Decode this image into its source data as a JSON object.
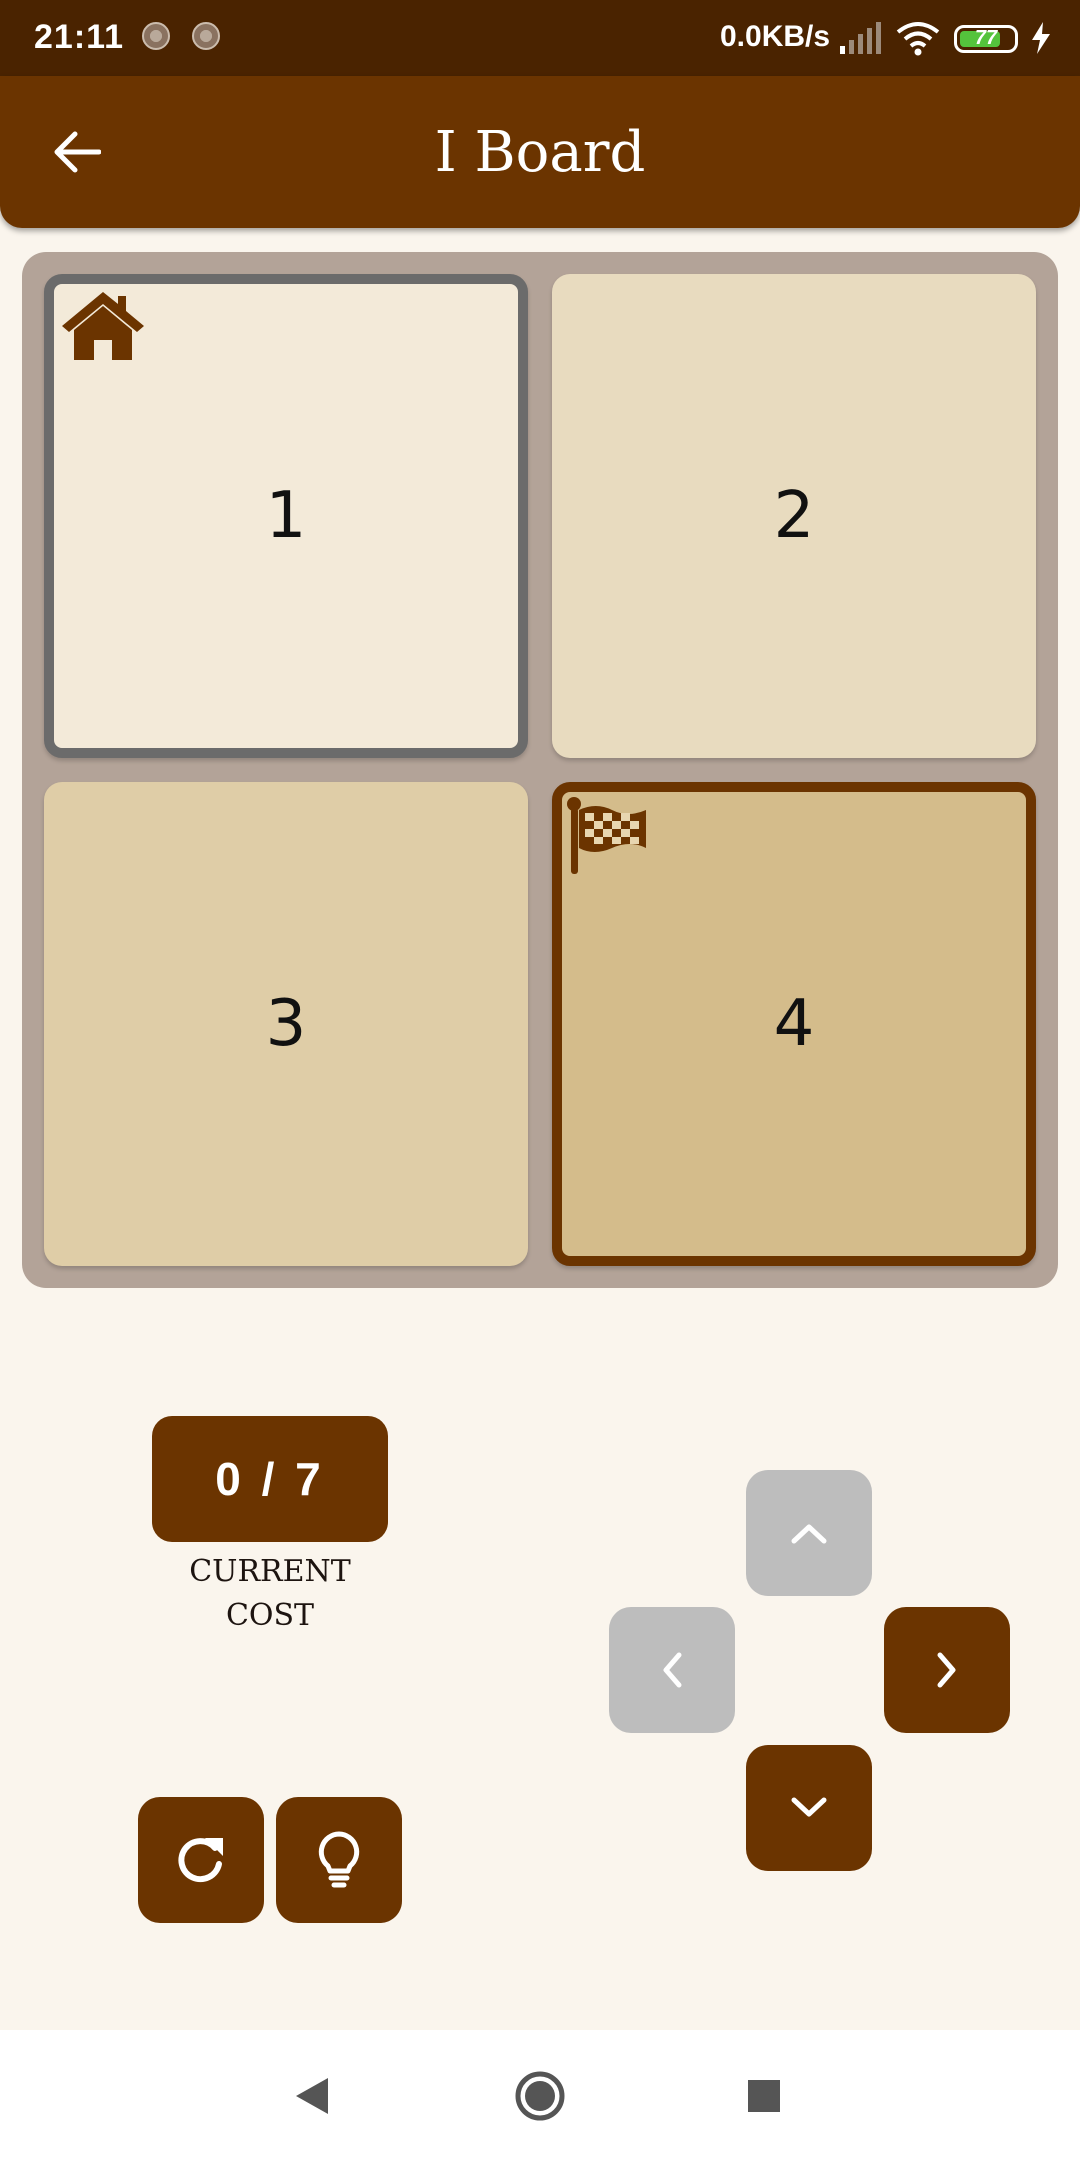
{
  "status_bar": {
    "time": "21:11",
    "network_speed": "0.0KB/s",
    "battery_level": "77",
    "icons": [
      "notification-dot-icon",
      "notification-dot-icon",
      "signal-icon",
      "wifi-icon",
      "battery-icon",
      "charging-bolt-icon"
    ]
  },
  "app_bar": {
    "title": "I Board",
    "back_icon": "arrow-left-icon"
  },
  "board": {
    "cells": [
      {
        "label": "1",
        "state": "start",
        "icon": "home-icon",
        "background": "#f3ead9",
        "border": "#6b6b6b"
      },
      {
        "label": "2",
        "state": "normal",
        "icon": "",
        "background": "#e8dbbf",
        "border": ""
      },
      {
        "label": "3",
        "state": "normal",
        "icon": "",
        "background": "#dfcda7",
        "border": ""
      },
      {
        "label": "4",
        "state": "goal",
        "icon": "checkered-flag-icon",
        "background": "#d4bc8b",
        "border": "#6b3400"
      }
    ]
  },
  "cost": {
    "value": "0 / 7",
    "label": "CURRENT\nCOST"
  },
  "controls": {
    "up": {
      "icon": "chevron-up-icon",
      "enabled": false
    },
    "left": {
      "icon": "chevron-left-icon",
      "enabled": false
    },
    "right": {
      "icon": "chevron-right-icon",
      "enabled": true
    },
    "down": {
      "icon": "chevron-down-icon",
      "enabled": true
    },
    "reset": {
      "icon": "refresh-icon"
    },
    "hint": {
      "icon": "lightbulb-icon"
    }
  },
  "nav_bar": {
    "icons": [
      "back-triangle-icon",
      "home-circle-icon",
      "recents-square-icon"
    ]
  },
  "colors": {
    "primary": "#6b3400",
    "status_bar": "#4a2300",
    "background": "#faf5ed",
    "board": "#b3a398",
    "disabled": "#bdbdbd"
  }
}
